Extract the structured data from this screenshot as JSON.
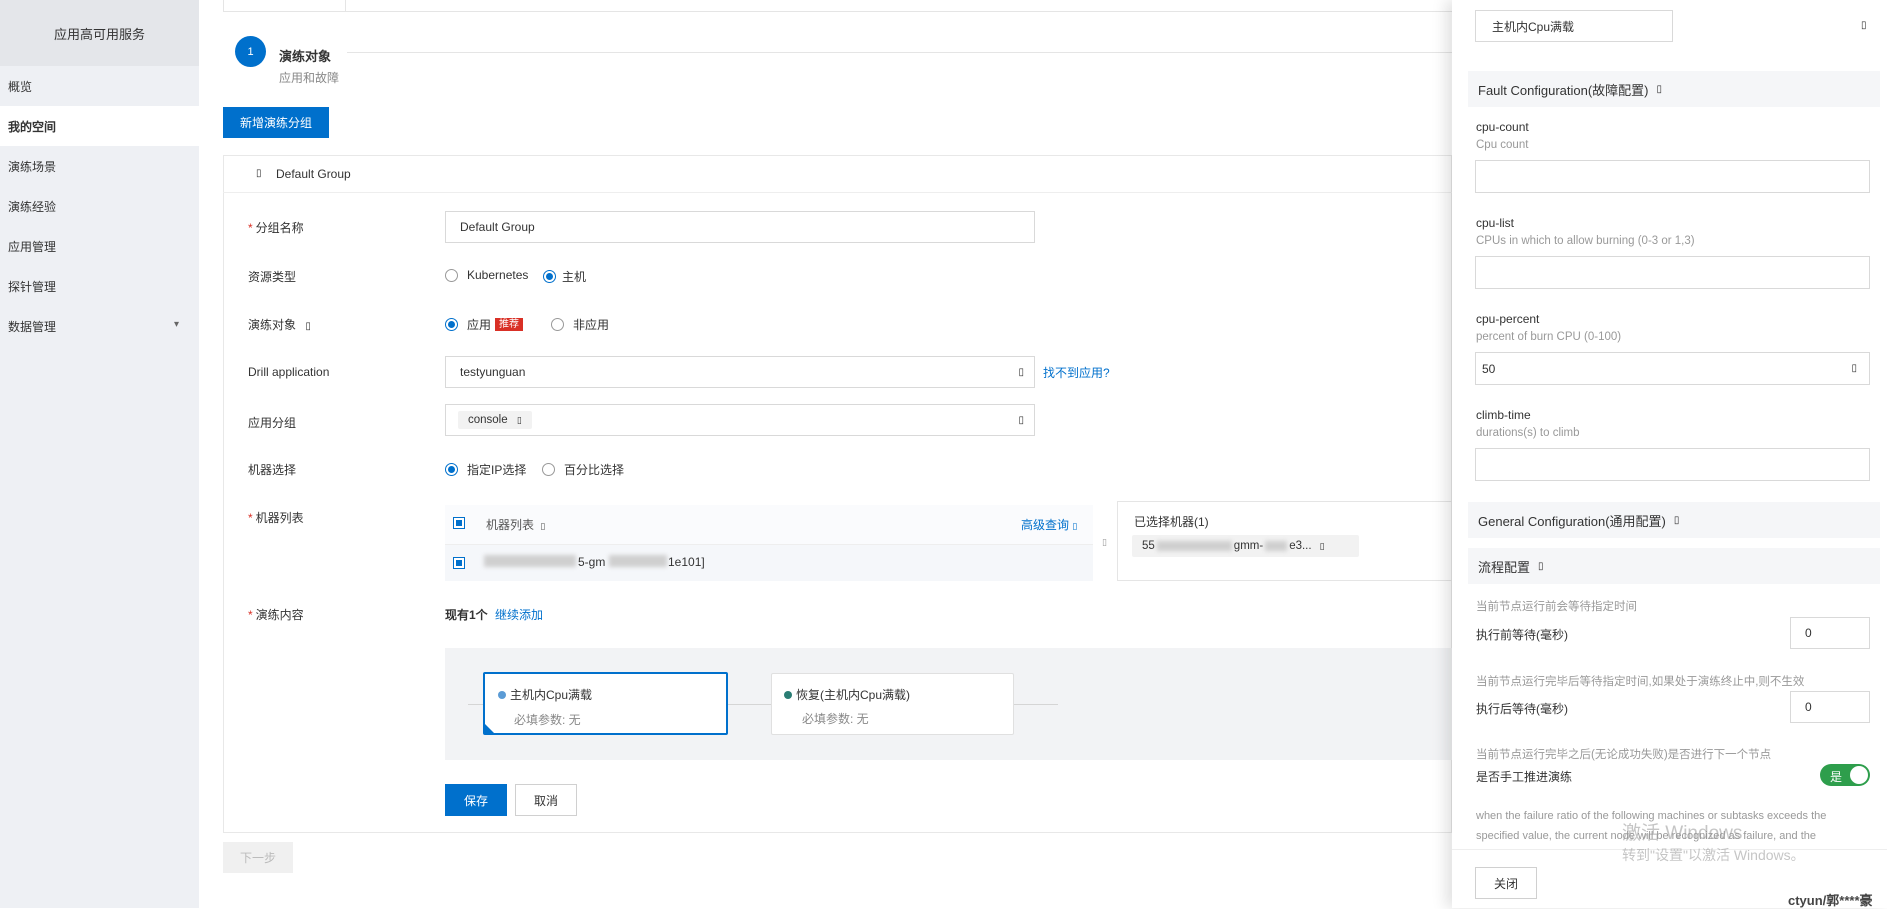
{
  "sidebar": {
    "title": "应用高可用服务",
    "items": [
      {
        "label": "概览"
      },
      {
        "label": "我的空间"
      },
      {
        "label": "演练场景"
      },
      {
        "label": "演练经验"
      },
      {
        "label": "应用管理"
      },
      {
        "label": "探针管理"
      },
      {
        "label": "数据管理"
      }
    ]
  },
  "step": {
    "number": "1",
    "title": "演练对象",
    "subtitle": "应用和故障"
  },
  "add_group_button": "新增演练分组",
  "group": {
    "name": "Default Group",
    "fields": {
      "group_name_label": "分组名称",
      "group_name_value": "Default Group",
      "resource_type_label": "资源类型",
      "resource_options": [
        "Kubernetes",
        "主机"
      ],
      "target_label": "演练对象",
      "target_options": [
        "应用",
        "非应用"
      ],
      "recommend_tag": "推荐",
      "drill_app_label": "Drill application",
      "drill_app_value": "testyunguan",
      "cant_find_app": "找不到应用?",
      "app_group_label": "应用分组",
      "app_group_tag": "console",
      "machine_select_label": "机器选择",
      "machine_select_options": [
        "指定IP选择",
        "百分比选择"
      ],
      "machine_list_label": "机器列表",
      "machine_list_header": "机器列表",
      "advanced_query": "高级查询",
      "machine_row_text_1": "5-gm",
      "machine_row_text_2": "1e101]",
      "selected_machines_title": "已选择机器(1)",
      "selected_tag_prefix": "55",
      "selected_tag_mid": "gmm-",
      "selected_tag_suffix": "e3...",
      "content_label": "演练内容",
      "content_count": "现有1个",
      "continue_add": "继续添加"
    }
  },
  "flow": {
    "nodes": [
      {
        "title": "主机内Cpu满载",
        "param": "必填参数: 无",
        "dot_color": "#5b9bd5"
      },
      {
        "title": "恢复(主机内Cpu满载)",
        "param": "必填参数: 无",
        "dot_color": "#2a7d74"
      }
    ]
  },
  "buttons": {
    "save": "保存",
    "cancel": "取消",
    "next": "下一步"
  },
  "panel": {
    "name_value": "主机内Cpu满载",
    "fault_section": "Fault Configuration(故障配置)",
    "fields": [
      {
        "title": "cpu-count",
        "desc": "Cpu count",
        "value": ""
      },
      {
        "title": "cpu-list",
        "desc": "CPUs in which to allow burning (0-3 or 1,3)",
        "value": ""
      },
      {
        "title": "cpu-percent",
        "desc": "percent of burn CPU (0-100)",
        "value": "50"
      },
      {
        "title": "climb-time",
        "desc": "durations(s) to climb",
        "value": ""
      }
    ],
    "general_section": "General Configuration(通用配置)",
    "flow_section": "流程配置",
    "before_desc": "当前节点运行前会等待指定时间",
    "before_label": "执行前等待(毫秒)",
    "before_value": "0",
    "after_desc": "当前节点运行完毕后等待指定时间,如果处于演练终止中,则不生效",
    "after_label": "执行后等待(毫秒)",
    "after_value": "0",
    "manual_desc": "当前节点运行完毕之后(无论成功失败)是否进行下一个节点",
    "manual_label": "是否手工推进演练",
    "manual_toggle": "是",
    "failure_desc_1": "when the failure ratio of the following machines or subtasks exceeds the",
    "failure_desc_2": "specified value, the current node will be recognized as failure, and the",
    "close_button": "关闭"
  },
  "watermark": {
    "line1": "激活 Windows",
    "line2": "转到\"设置\"以激活 Windows。"
  },
  "footer_user": "ctyun/郭****豪",
  "colors": {
    "primary": "#0070cc",
    "toggle_on": "#2e9e4c",
    "required": "#d93026"
  }
}
